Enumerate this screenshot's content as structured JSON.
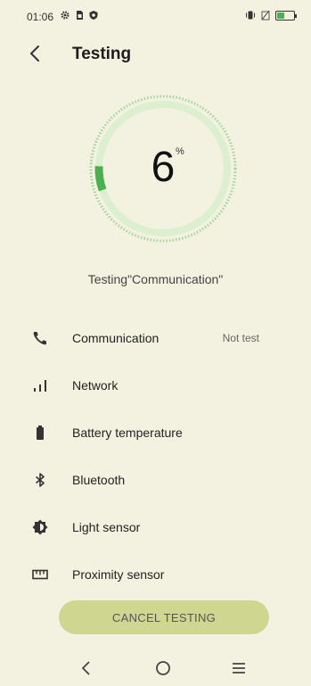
{
  "status_bar": {
    "time": "01:06",
    "left_icons": [
      "gear-icon",
      "sim-card-icon",
      "shield-icon"
    ],
    "right_icons": [
      "vibrate-icon",
      "no-sim-icon",
      "battery-charging-icon"
    ]
  },
  "header": {
    "title": "Testing",
    "back_icon": "chevron-left-icon"
  },
  "progress": {
    "value": "6",
    "unit": "%",
    "fraction": 0.06
  },
  "testing_status": "Testing\"Communication\"",
  "tests": [
    {
      "label": "Communication",
      "status": "Not test",
      "icon": "phone-icon"
    },
    {
      "label": "Network",
      "status": "",
      "icon": "signal-bars-icon"
    },
    {
      "label": "Battery temperature",
      "status": "",
      "icon": "battery-icon"
    },
    {
      "label": "Bluetooth",
      "status": "",
      "icon": "bluetooth-icon"
    },
    {
      "label": "Light sensor",
      "status": "",
      "icon": "brightness-icon"
    },
    {
      "label": "Proximity sensor",
      "status": "",
      "icon": "ruler-icon"
    }
  ],
  "cancel_button": "CANCEL TESTING",
  "nav": {
    "back_icon": "nav-back-icon",
    "home_icon": "nav-home-icon",
    "recents_icon": "nav-menu-icon"
  },
  "colors": {
    "background": "#f3f1e0",
    "progress_green": "#4caf50",
    "ring_light": "#d9ecc7",
    "cancel_button": "#cfd690"
  }
}
